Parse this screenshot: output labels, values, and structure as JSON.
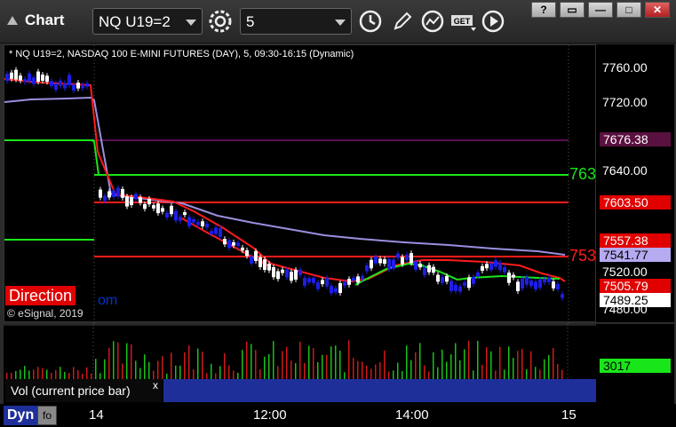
{
  "window": {
    "title": "Chart",
    "symbol_value": "NQ U19=2",
    "interval_value": "5",
    "controls": {
      "help": "?",
      "restore": "▭",
      "minimize": "—",
      "maximize": "□",
      "close": "✕"
    }
  },
  "toolbar_icons": [
    "settings-gear-icon",
    "clock-icon",
    "draw-pencil-icon",
    "study-icon",
    "get-data-icon",
    "play-icon"
  ],
  "chart": {
    "caption": "* NQ U19=2, NASDAQ 100 E-MINI FUTURES (DAY), 5, 09:30-16:15 (Dynamic)",
    "copyright": "© eSignal, 2019",
    "direction_label": "Direction",
    "direction_tail": "om",
    "level_labels": {
      "upper": "763",
      "lower": "753"
    },
    "colors": {
      "up": "#ffffff",
      "down": "#1e1ee8",
      "ma_red": "#ff1b1b",
      "ma_purple": "#9b8fe0",
      "ma_green": "#19e619",
      "level_green": "#19e619",
      "level_red": "#ff1b1b",
      "level_purple": "#5a1050"
    }
  },
  "price_axis": {
    "ticks": [
      "7760.00",
      "7720.00",
      "7640.00",
      "7520.00",
      "7480.00"
    ],
    "tags": [
      {
        "value": "7676.38",
        "bg": "#5a1040",
        "fg": "#ffffff"
      },
      {
        "value": "7603.50",
        "bg": "#e00000",
        "fg": "#ffffff"
      },
      {
        "value": "7557.38",
        "bg": "#e00000",
        "fg": "#ffffff"
      },
      {
        "value": "7541.77",
        "bg": "#b6aaf0",
        "fg": "#000000"
      },
      {
        "value": "7505.79",
        "bg": "#e00000",
        "fg": "#ffffff"
      },
      {
        "value": "7489.25",
        "bg": "#ffffff",
        "fg": "#000000"
      }
    ]
  },
  "volume": {
    "label": "Vol (current price bar)",
    "close_symbol": "x",
    "current_value": "3017",
    "current_bg": "#19e619"
  },
  "time_axis": {
    "labels": [
      "14",
      "12:00",
      "14:00",
      "15"
    ],
    "dyn_label": "Dyn",
    "dyn_icon": "fo"
  }
}
